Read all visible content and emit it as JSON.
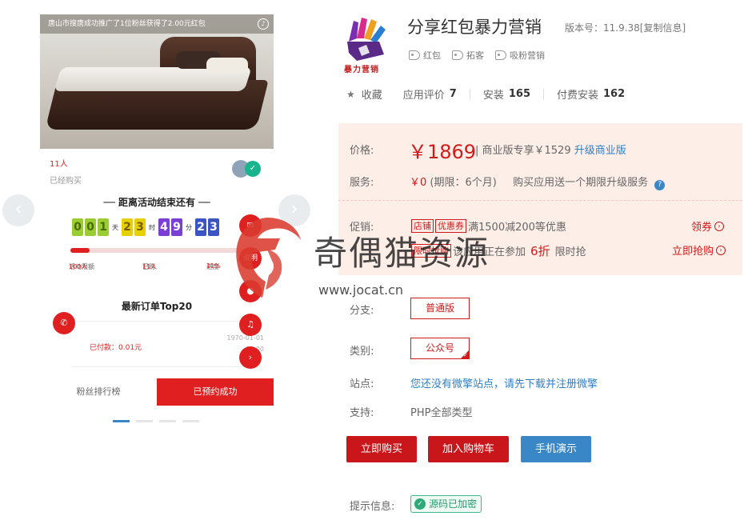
{
  "gallery": {
    "ticker": "唐山市搜唐成功推广了1位粉丝获得了2.00元红包",
    "buyer_count": "11人",
    "buyer_label": "已经购买",
    "countdown_title": "距离活动结束还有",
    "countdown": {
      "days": [
        "0",
        "0",
        "1"
      ],
      "day_unit": "天",
      "hours": [
        "2",
        "3"
      ],
      "hour_unit": "时",
      "minutes": [
        "4",
        "9"
      ],
      "minute_unit": "分",
      "seconds": [
        "2",
        "3"
      ]
    },
    "progress": {
      "fraction": 0.11,
      "limit_label": "活动限额",
      "limit_value": "100人",
      "bought_label": "已购",
      "bought_value": "11人",
      "progress_label": "进度",
      "progress_value": "11%"
    },
    "orders_title": "最新订单Top20",
    "order_date": "1970-01-01",
    "order_time": "08:00",
    "paid_label": "已付款：0.01元",
    "tab_fans": "粉丝排行榜",
    "tab_reserved": "已预约成功",
    "fab_labels": [
      "",
      "说明",
      "",
      "",
      ""
    ]
  },
  "product": {
    "logo_text": "暴力营销",
    "title": "分享红包暴力营销",
    "version": "版本号：11.9.38[复制信息]",
    "tags": [
      "红包",
      "拓客",
      "吸粉营销"
    ],
    "favorite": "收藏",
    "rating_label": "应用评价",
    "rating_value": "7",
    "install_label": "安装",
    "install_value": "165",
    "paid_install_label": "付费安装",
    "paid_install_value": "162"
  },
  "pricing": {
    "price_label": "价格:",
    "price": "￥1869",
    "biz_text": "| 商业版专享￥1529",
    "upgrade_link": "升级商业版",
    "service_label": "服务:",
    "service_price": "￥0",
    "service_period": "(期限：6个月)",
    "service_desc": "购买应用送一个期限升级服务",
    "promo_label": "促销:",
    "promo_badge1": "店铺",
    "promo_badge2": "优惠券",
    "promo_text1": "满1500减200等优惠",
    "promo_action1": "领券",
    "promo_badge3": "限时抢购",
    "promo_text2a": "该应用正在参加",
    "promo_discount": "6折",
    "promo_text2b": "限时抢",
    "promo_action2": "立即抢购"
  },
  "options": {
    "branch_label": "分支:",
    "branch_value": "普通版",
    "category_label": "类别:",
    "category_value": "公众号",
    "site_label": "站点:",
    "site_text": "您还没有微擎站点，请先下载并注册微擎",
    "support_label": "支持:",
    "support_text": "PHP全部类型"
  },
  "actions": {
    "buy": "立即购买",
    "cart": "加入购物车",
    "demo": "手机演示"
  },
  "notice": {
    "label": "提示信息:",
    "encrypted": "源码已加密"
  },
  "watermark": {
    "text": "奇偶猫资源",
    "url": "www.jocat.cn"
  },
  "colors": {
    "accent_red": "#c9161a",
    "link_blue": "#2f7fc7",
    "price_bg": "#fdeee8",
    "success_green": "#2eaa7a"
  }
}
